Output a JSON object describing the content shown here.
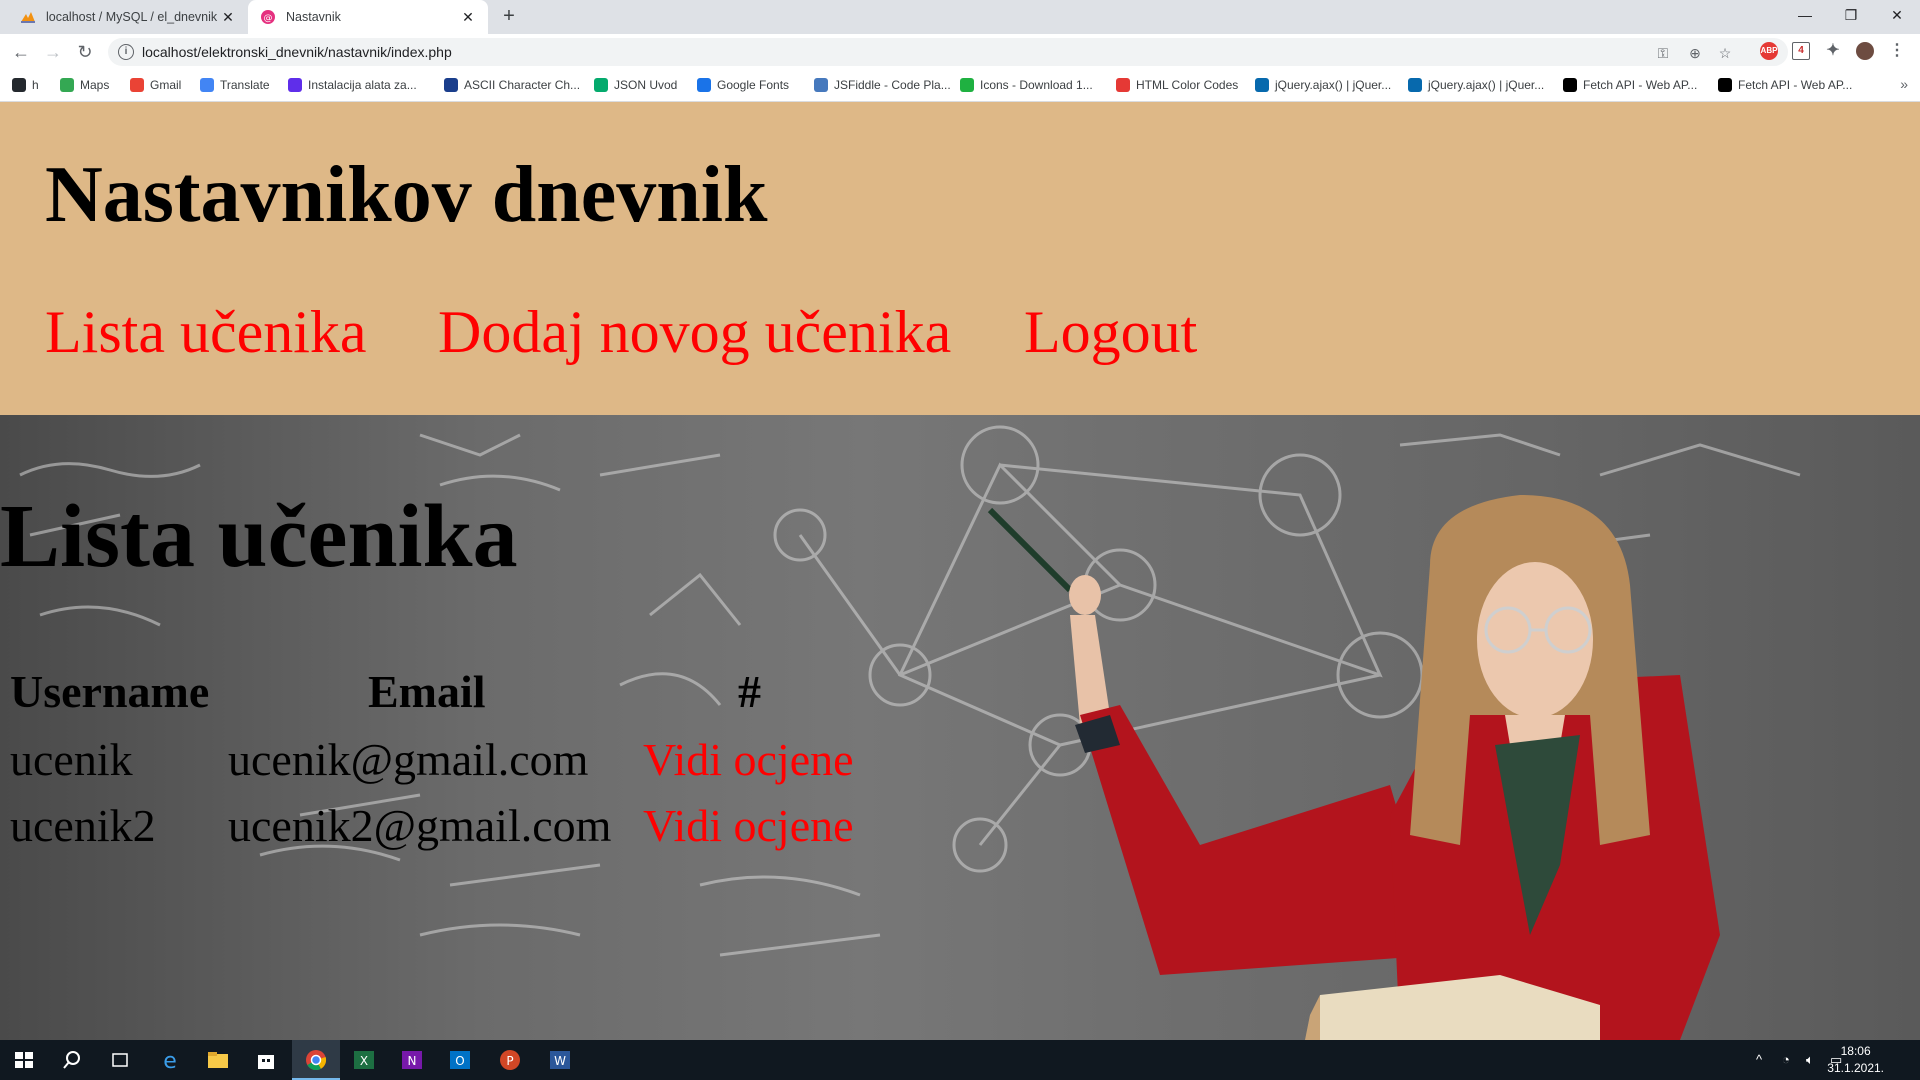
{
  "browser": {
    "tabs": [
      {
        "title": "localhost / MySQL / el_dnevnik /",
        "active": false,
        "icon": "phpmyadmin-icon"
      },
      {
        "title": "Nastavnik",
        "active": true,
        "icon": "site-icon"
      }
    ],
    "url": "localhost/elektronski_dnevnik/nastavnik/index.php",
    "bookmarks": [
      {
        "label": "h",
        "icon": "github-icon",
        "color": "#24292e"
      },
      {
        "label": "Maps",
        "icon": "maps-icon",
        "color": "#34a853"
      },
      {
        "label": "Gmail",
        "icon": "gmail-icon",
        "color": "#ea4335"
      },
      {
        "label": "Translate",
        "icon": "translate-icon",
        "color": "#4285f4"
      },
      {
        "label": "Instalacija alata za...",
        "icon": "wp-icon",
        "color": "#5f2eea"
      },
      {
        "label": "ASCII Character Ch...",
        "icon": "ascii-icon",
        "color": "#1a3e8c"
      },
      {
        "label": "JSON Uvod",
        "icon": "w3-icon",
        "color": "#04aa6d"
      },
      {
        "label": "Google Fonts",
        "icon": "fonts-icon",
        "color": "#1a73e8"
      },
      {
        "label": "JSFiddle - Code Pla...",
        "icon": "jsfiddle-icon",
        "color": "#4679bd"
      },
      {
        "label": "Icons - Download 1...",
        "icon": "icons8-icon",
        "color": "#1fb141"
      },
      {
        "label": "HTML Color Codes",
        "icon": "colorcodes-icon",
        "color": "#e53935"
      },
      {
        "label": "jQuery.ajax() | jQuer...",
        "icon": "jquery-icon",
        "color": "#0769ad"
      },
      {
        "label": "jQuery.ajax() | jQuer...",
        "icon": "jquery-icon",
        "color": "#0769ad"
      },
      {
        "label": "Fetch API - Web AP...",
        "icon": "mdn-icon",
        "color": "#000000"
      },
      {
        "label": "Fetch API - Web AP...",
        "icon": "mdn-icon",
        "color": "#000000"
      }
    ],
    "bookmarks_more": "»"
  },
  "page": {
    "site_title": "Nastavnikov dnevnik",
    "nav": {
      "list": "Lista učenika",
      "add": "Dodaj novog učenika",
      "logout": "Logout"
    },
    "list_title": "Lista učenika",
    "table": {
      "headers": [
        "Username",
        "Email",
        "#"
      ],
      "rows": [
        {
          "username": "ucenik",
          "email": "ucenik@gmail.com",
          "action": "Vidi ocjene"
        },
        {
          "username": "ucenik2",
          "email": "ucenik2@gmail.com",
          "action": "Vidi ocjene"
        }
      ]
    },
    "colors": {
      "header_bg": "#deb887",
      "link": "#ff0000"
    }
  },
  "taskbar": {
    "time": "18:06",
    "date": "31.1.2021."
  }
}
